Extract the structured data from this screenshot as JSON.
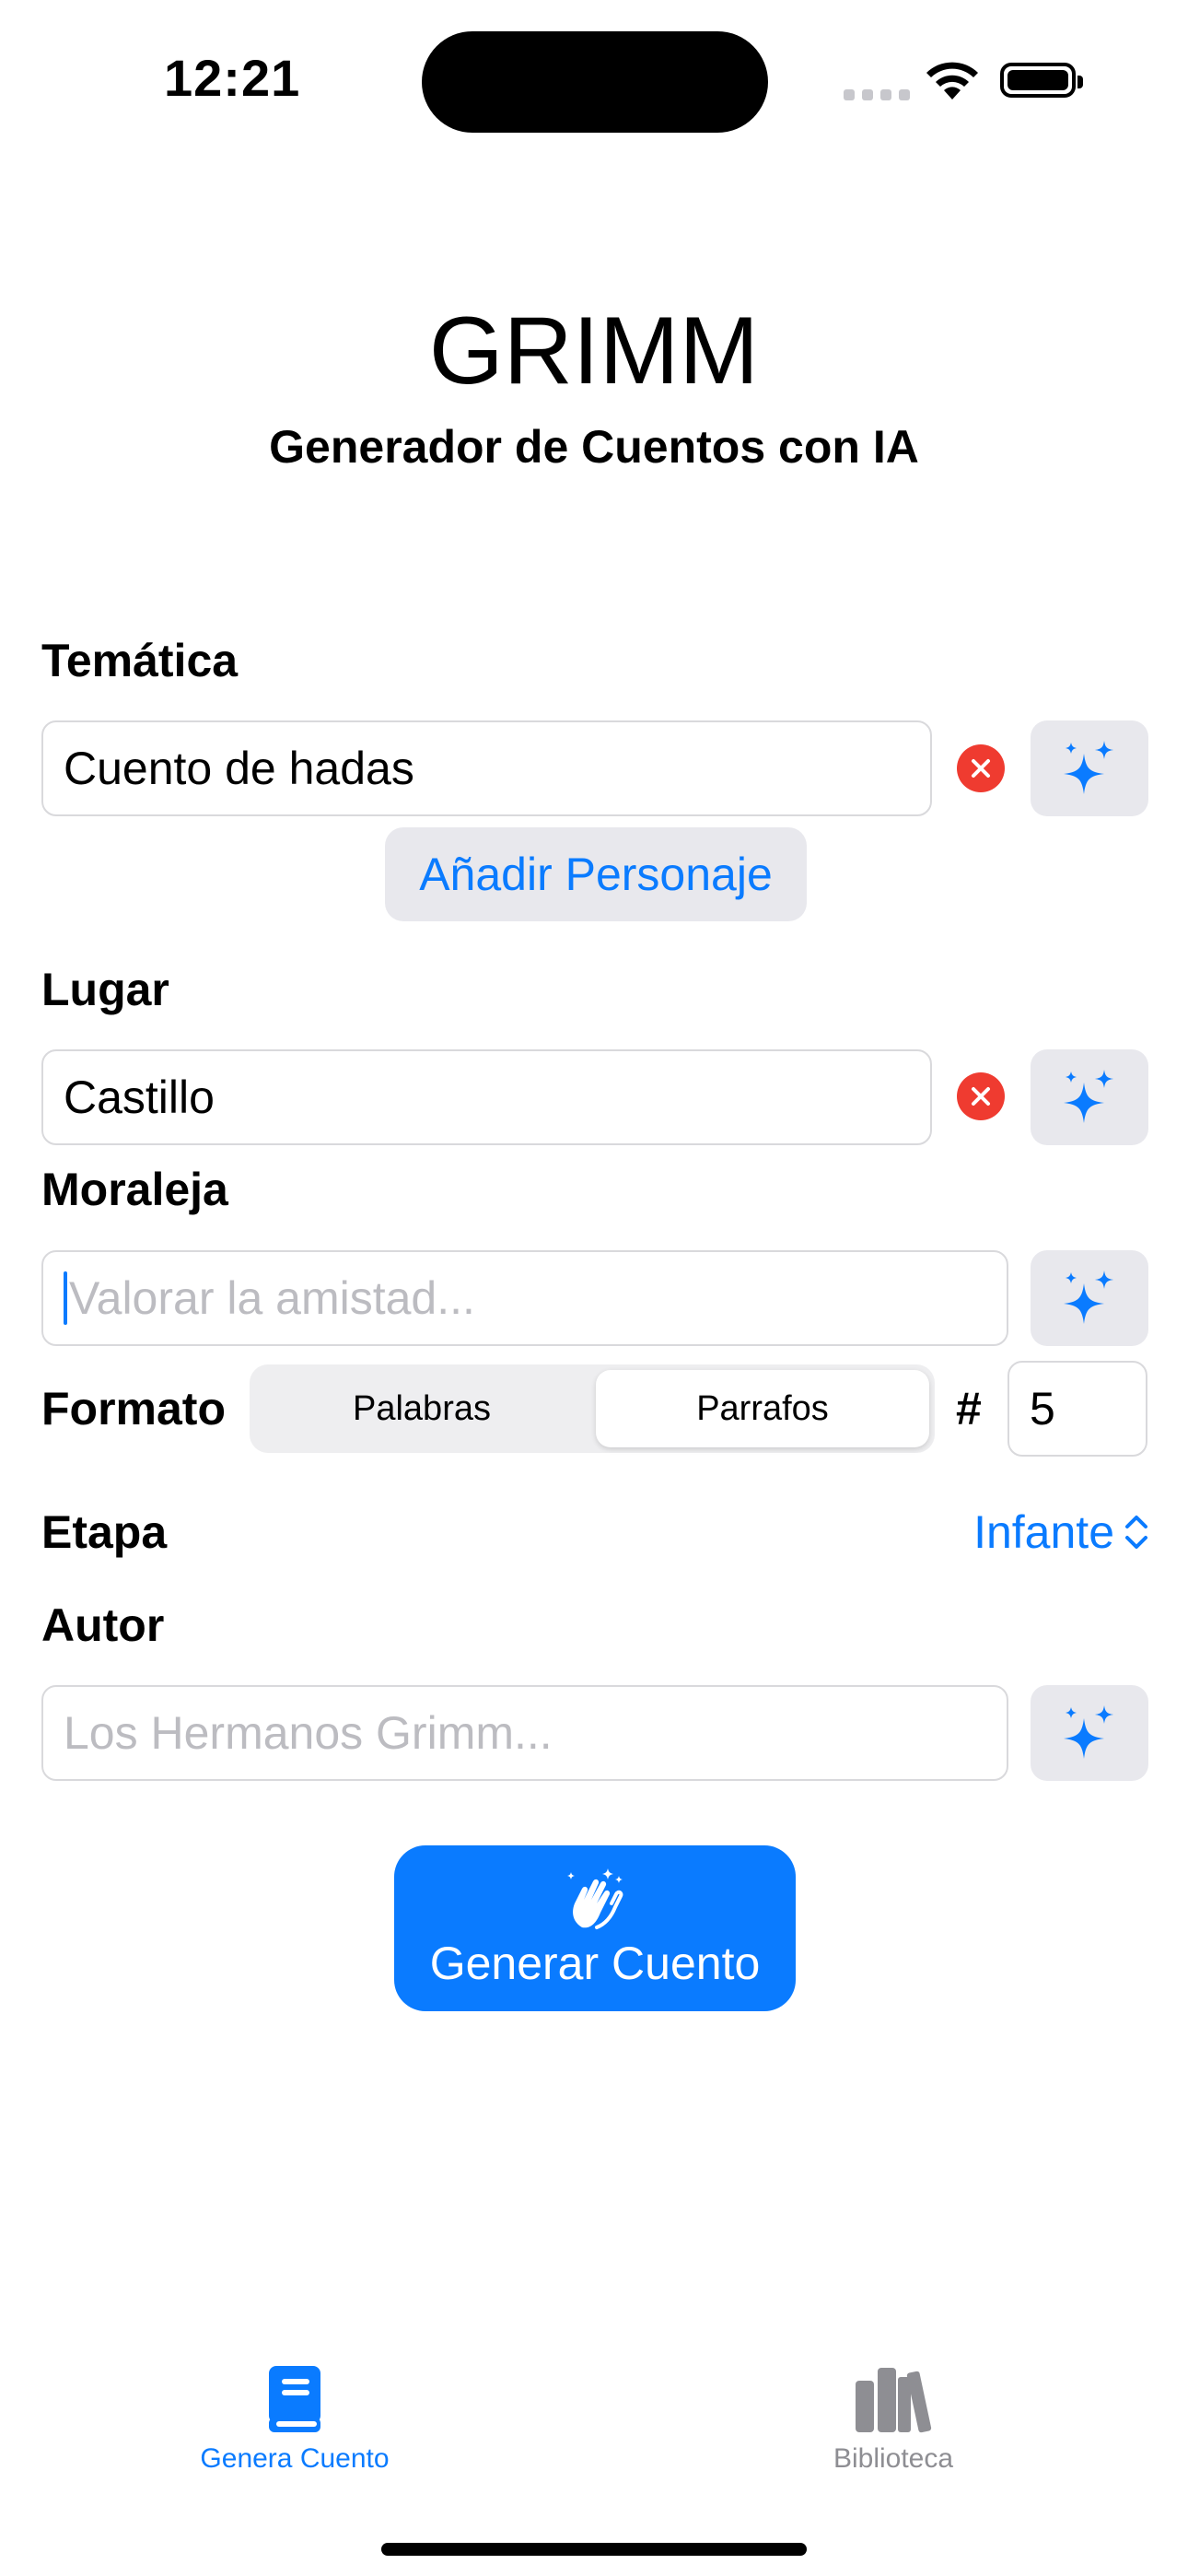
{
  "status_bar": {
    "time": "12:21"
  },
  "header": {
    "title": "GRIMM",
    "subtitle": "Generador de Cuentos con IA"
  },
  "form": {
    "tematica": {
      "label": "Temática",
      "value": "Cuento de hadas"
    },
    "add_character_label": "Añadir Personaje",
    "lugar": {
      "label": "Lugar",
      "value": "Castillo"
    },
    "moraleja": {
      "label": "Moraleja",
      "placeholder": "Valorar la amistad..."
    },
    "formato": {
      "label": "Formato",
      "options": [
        "Palabras",
        "Parrafos"
      ],
      "selected": "Parrafos",
      "count_symbol": "#",
      "count_value": "5"
    },
    "etapa": {
      "label": "Etapa",
      "value": "Infante"
    },
    "autor": {
      "label": "Autor",
      "placeholder": "Los Hermanos Grimm..."
    }
  },
  "generate_button": {
    "label": "Generar Cuento",
    "icon": "hands-clap-sparkles-icon"
  },
  "tab_bar": {
    "items": [
      {
        "label": "Genera Cuento",
        "icon": "book-icon",
        "active": true
      },
      {
        "label": "Biblioteca",
        "icon": "books-icon",
        "active": false
      }
    ]
  },
  "colors": {
    "accent": "#0a7bff",
    "clear": "#ef3b30",
    "inactive": "#8e8e93",
    "button_bg": "#e8e8ed"
  }
}
